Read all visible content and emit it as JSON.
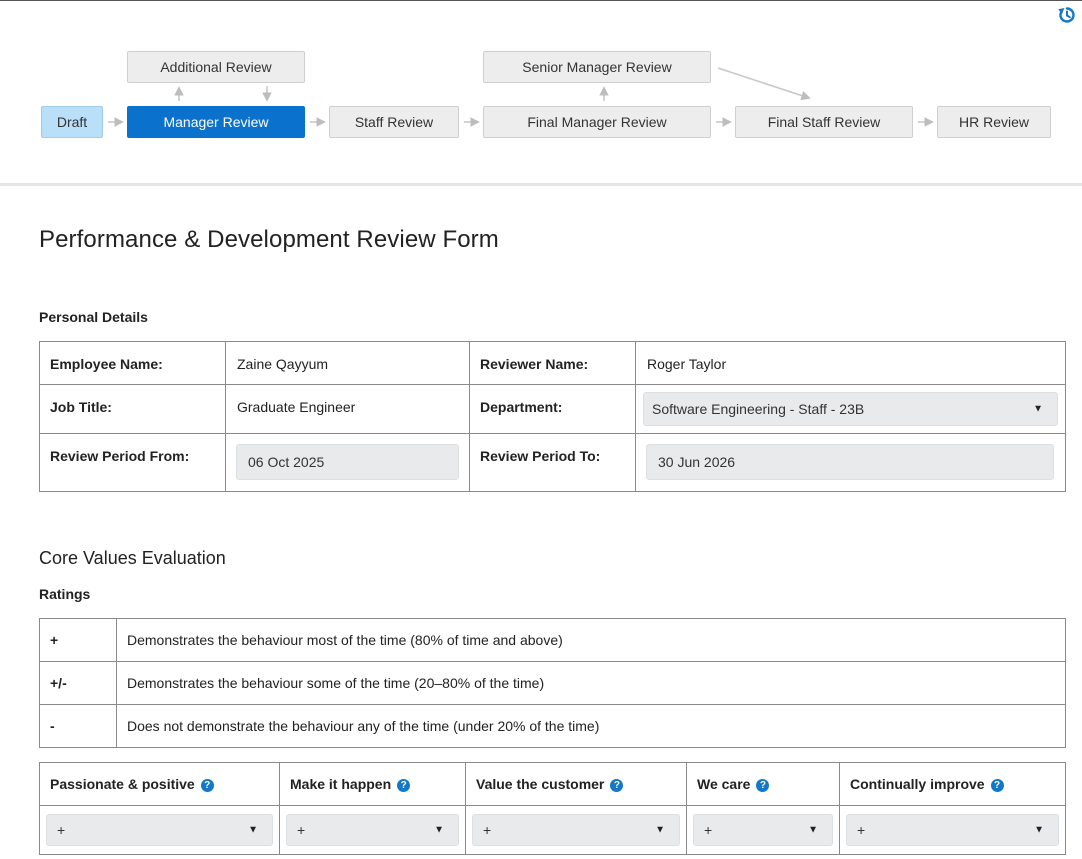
{
  "workflow": {
    "nodes": {
      "draft": "Draft",
      "manager_review": "Manager Review",
      "additional_review": "Additional Review",
      "staff_review": "Staff Review",
      "final_manager_review": "Final Manager Review",
      "senior_manager_review": "Senior Manager Review",
      "final_staff_review": "Final Staff Review",
      "hr_review": "HR Review"
    },
    "active": "Manager Review",
    "colors": {
      "active": "#0a72cc",
      "draft": "#b9dff9",
      "node": "#ededed"
    }
  },
  "form": {
    "title": "Performance & Development Review Form",
    "personal_details": {
      "heading": "Personal Details",
      "employee_name_label": "Employee Name:",
      "employee_name": "Zaine Qayyum",
      "reviewer_name_label": "Reviewer Name:",
      "reviewer_name": "Roger Taylor",
      "job_title_label": "Job Title:",
      "job_title": "Graduate Engineer",
      "department_label": "Department:",
      "department": "Software Engineering - Staff - 23B",
      "period_from_label": "Review Period From:",
      "period_from": "06 Oct 2025",
      "period_to_label": "Review Period To:",
      "period_to": "30 Jun 2026"
    },
    "core_values": {
      "heading": "Core Values Evaluation",
      "ratings_heading": "Ratings",
      "ratings": [
        {
          "symbol": "+",
          "description": "Demonstrates the behaviour most of the time (80% of time and above)"
        },
        {
          "symbol": "+/-",
          "description": "Demonstrates the behaviour some of the time (20–80% of the time)"
        },
        {
          "symbol": "-",
          "description": "Does not demonstrate the behaviour any of the time (under 20% of the time)"
        }
      ],
      "values": [
        {
          "name": "Passionate & positive",
          "rating": "+"
        },
        {
          "name": "Make it happen",
          "rating": "+"
        },
        {
          "name": "Value the customer",
          "rating": "+"
        },
        {
          "name": "We care",
          "rating": "+"
        },
        {
          "name": "Continually improve",
          "rating": "+"
        }
      ]
    }
  },
  "icons": {
    "reset": "reset-icon",
    "help": "help-icon",
    "dropdown": "chevron-down-icon"
  }
}
